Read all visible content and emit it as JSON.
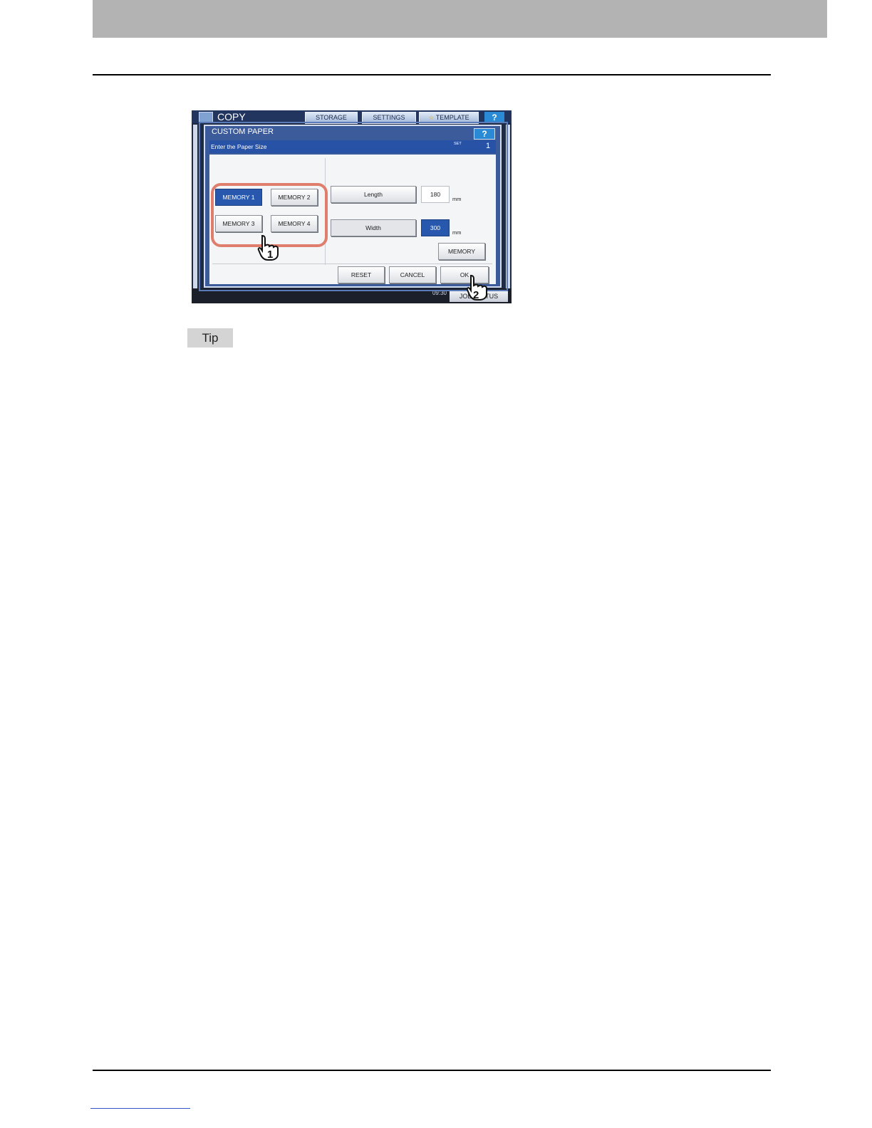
{
  "screen": {
    "app_title": "COPY",
    "top_buttons": [
      "STORAGE",
      "SETTINGS",
      "TEMPLATE"
    ],
    "help_label": "?",
    "bottom_time": "09:30",
    "bottom_button": "JOB STATUS",
    "dialog": {
      "title": "CUSTOM PAPER",
      "help_label": "?",
      "subtitle": "Enter the Paper Size",
      "set_label": "SET",
      "set_value": "1",
      "memory_buttons": [
        "MEMORY 1",
        "MEMORY 2",
        "MEMORY 3",
        "MEMORY 4"
      ],
      "length_label": "Length",
      "length_value": "180",
      "width_label": "Width",
      "width_value": "300",
      "unit": "mm",
      "memory_button": "MEMORY",
      "reset_label": "RESET",
      "cancel_label": "CANCEL",
      "ok_label": "OK"
    },
    "callouts": [
      "1",
      "2"
    ]
  },
  "tip_label": "Tip"
}
